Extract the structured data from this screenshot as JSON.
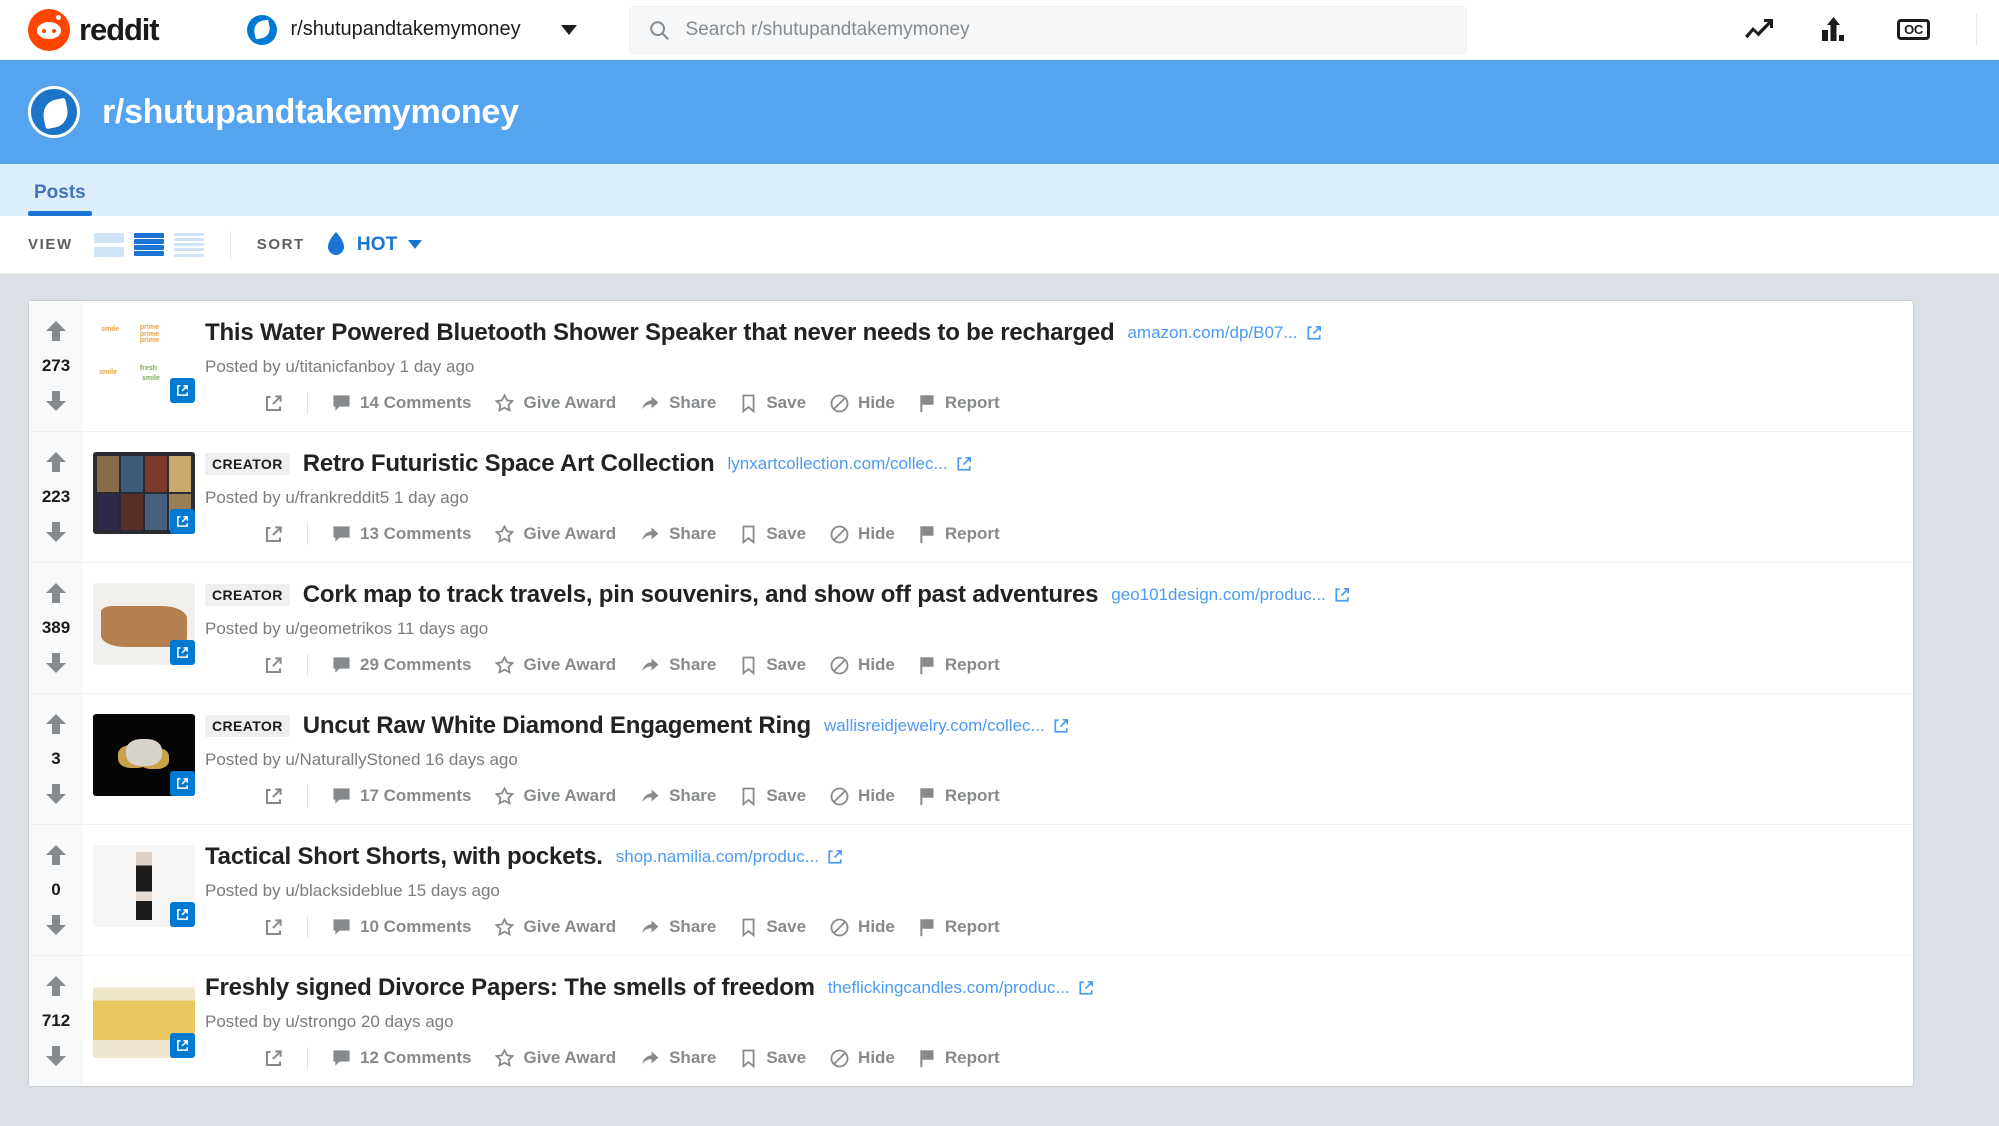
{
  "header": {
    "logo_text": "reddit",
    "community_switcher": "r/shutupandtakemymoney",
    "search_placeholder": "Search r/shutupandtakemymoney",
    "search_value": "",
    "icons": [
      {
        "name": "trending-icon",
        "label": "Trending"
      },
      {
        "name": "top-posts-icon",
        "label": "Top Posts"
      },
      {
        "name": "original-content-icon",
        "label": "OC"
      }
    ]
  },
  "banner": {
    "title": "r/shutupandtakemymoney",
    "avatar_icon": "subreddit-avatar"
  },
  "tabs": [
    {
      "label": "Posts",
      "active": true
    }
  ],
  "toolbar": {
    "view_label": "VIEW",
    "views": [
      {
        "name": "card-view",
        "selected": false
      },
      {
        "name": "classic-view",
        "selected": true
      },
      {
        "name": "compact-view",
        "selected": false
      }
    ],
    "sort_label": "SORT",
    "sort_value": "HOT",
    "sort_icon": "flame-icon"
  },
  "action_labels": {
    "give_award": "Give Award",
    "share": "Share",
    "save": "Save",
    "hide": "Hide",
    "report": "Report"
  },
  "posts": [
    {
      "score": "273",
      "creator": "",
      "title": "This Water Powered Bluetooth Shower Speaker that never needs to be recharged",
      "domain": "amazon.com/dp/B07...",
      "meta": "Posted by u/titanicfanboy 1 day ago",
      "comments": "14 Comments",
      "thumb": "t-smile"
    },
    {
      "score": "223",
      "creator": "CREATOR",
      "title": "Retro Futuristic Space Art Collection",
      "domain": "lynxartcollection.com/collec...",
      "meta": "Posted by u/frankreddit5 1 day ago",
      "comments": "13 Comments",
      "thumb": "t-posters"
    },
    {
      "score": "389",
      "creator": "CREATOR",
      "title": "Cork map to track travels, pin souvenirs, and show off past adventures",
      "domain": "geo101design.com/produc...",
      "meta": "Posted by u/geometrikos 11 days ago",
      "comments": "29 Comments",
      "thumb": "t-cork"
    },
    {
      "score": "3",
      "creator": "CREATOR",
      "title": "Uncut Raw White Diamond Engagement Ring",
      "domain": "wallisreidjewelry.com/collec...",
      "meta": "Posted by u/NaturallyStoned 16 days ago",
      "comments": "17 Comments",
      "thumb": "t-ring"
    },
    {
      "score": "0",
      "creator": "",
      "title": "Tactical Short Shorts, with pockets.",
      "domain": "shop.namilia.com/produc...",
      "meta": "Posted by u/blacksideblue 15 days ago",
      "comments": "10 Comments",
      "thumb": "t-model"
    },
    {
      "score": "712",
      "creator": "",
      "title": "Freshly signed Divorce Papers: The smells of freedom",
      "domain": "theflickingcandles.com/produc...",
      "meta": "Posted by u/strongo 20 days ago",
      "comments": "12 Comments",
      "thumb": "t-candle"
    }
  ],
  "colors": {
    "brand_orange": "#ff4500",
    "link_blue": "#0079d3",
    "banner_blue": "#55a4f0",
    "page_bg": "#dae0e6"
  }
}
